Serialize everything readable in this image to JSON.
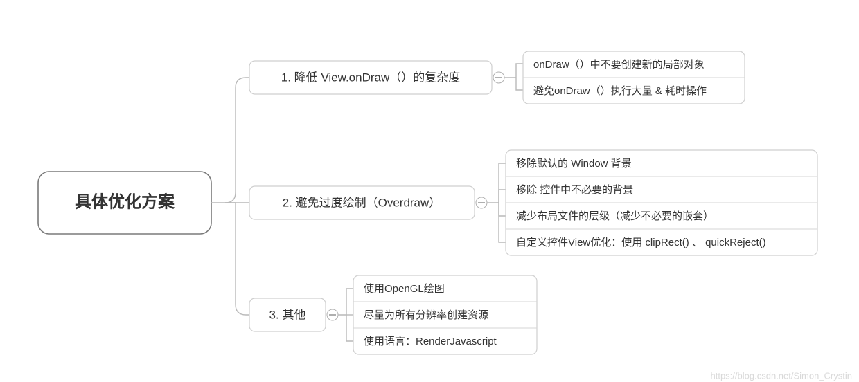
{
  "root": {
    "title": "具体优化方案"
  },
  "branches": [
    {
      "label": "1. 降低 View.onDraw（）的复杂度",
      "children": [
        "onDraw（）中不要创建新的局部对象",
        "避免onDraw（）执行大量 & 耗时操作"
      ]
    },
    {
      "label": "2. 避免过度绘制（Overdraw）",
      "children": [
        "移除默认的 Window 背景",
        "移除 控件中不必要的背景",
        "减少布局文件的层级（减少不必要的嵌套）",
        "自定义控件View优化：使用 clipRect() 、 quickReject()"
      ]
    },
    {
      "label": "3. 其他",
      "children": [
        "使用OpenGL绘图",
        "尽量为所有分辨率创建资源",
        "使用语言：RenderJavascript"
      ]
    }
  ],
  "watermark": "https://blog.csdn.net/Simon_Crystin"
}
